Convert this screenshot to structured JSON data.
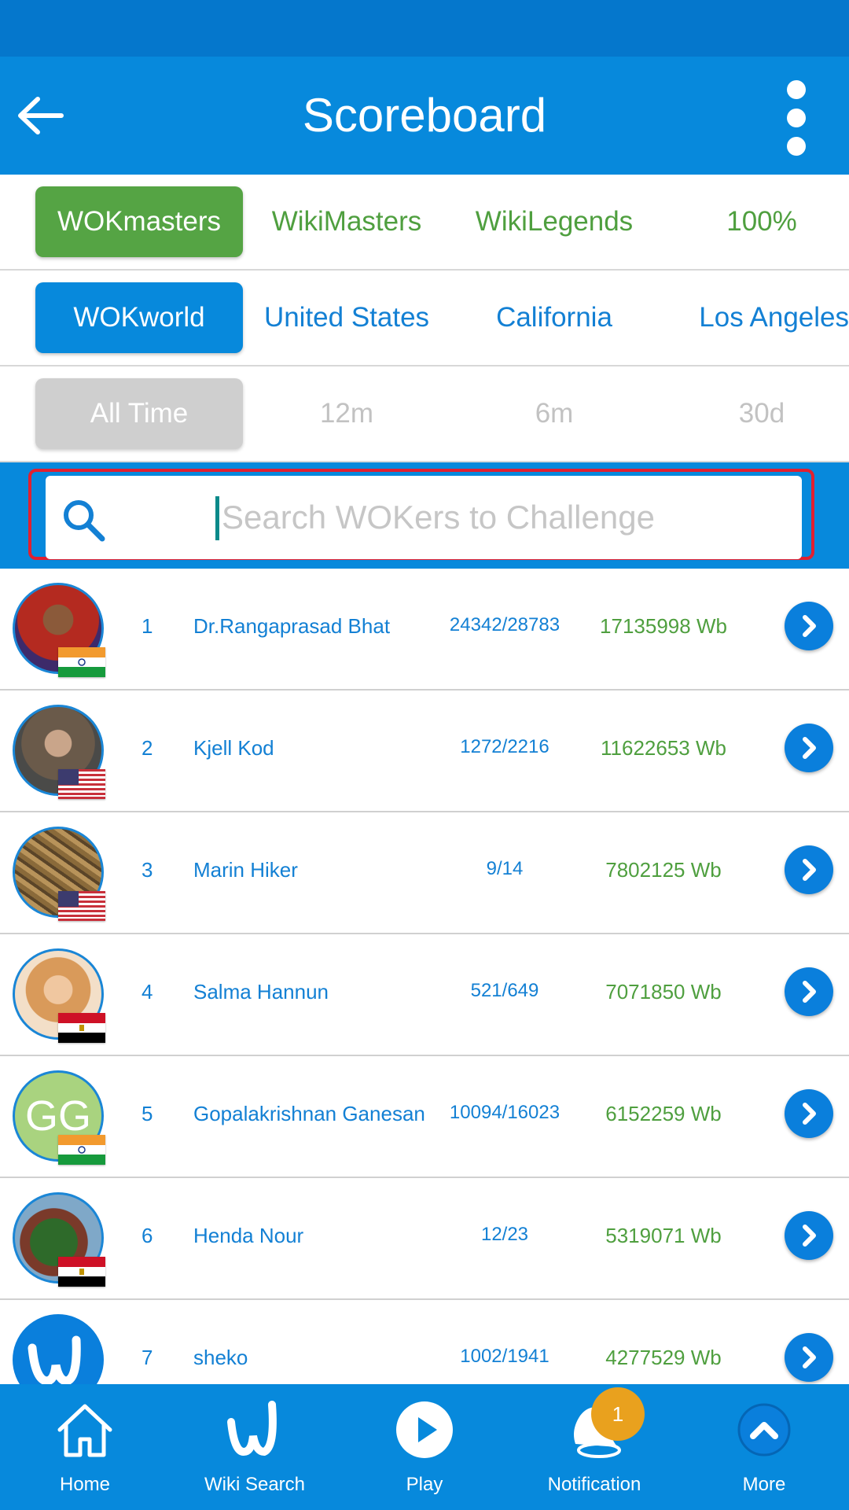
{
  "colors": {
    "primary": "#0789dc",
    "green": "#55a444",
    "link_blue": "#1380d4",
    "score_green": "#4f9f3f",
    "badge": "#e9a11e",
    "highlight": "#e12030"
  },
  "header": {
    "title": "Scoreboard",
    "back_icon": "arrow-left-icon",
    "menu_icon": "more-vertical-icon"
  },
  "tabs_category": [
    "WOKmasters",
    "WikiMasters",
    "WikiLegends",
    "100%"
  ],
  "tabs_region": [
    "WOKworld",
    "United States",
    "California",
    "Los Angeles"
  ],
  "tabs_period": [
    "All Time",
    "12m",
    "6m",
    "30d"
  ],
  "search": {
    "placeholder": "Search WOKers to Challenge",
    "icon": "search-icon"
  },
  "players": [
    {
      "rank": "1",
      "name": "Dr.Rangaprasad Bhat",
      "ratio": "24342/28783",
      "score": "17135998 Wb",
      "flag": "India",
      "avatar": "photo"
    },
    {
      "rank": "2",
      "name": "Kjell Kod",
      "ratio": "1272/2216",
      "score": "11622653 Wb",
      "flag": "United States",
      "avatar": "photo"
    },
    {
      "rank": "3",
      "name": "Marin Hiker",
      "ratio": "9/14",
      "score": "7802125 Wb",
      "flag": "United States",
      "avatar": "photo"
    },
    {
      "rank": "4",
      "name": "Salma Hannun",
      "ratio": "521/649",
      "score": "7071850 Wb",
      "flag": "Egypt",
      "avatar": "photo"
    },
    {
      "rank": "5",
      "name": "Gopalakrishnan Ganesan",
      "ratio": "10094/16023",
      "score": "6152259 Wb",
      "flag": "India",
      "avatar": "GG"
    },
    {
      "rank": "6",
      "name": "Henda Nour",
      "ratio": "12/23",
      "score": "5319071 Wb",
      "flag": "Egypt",
      "avatar": "photo"
    },
    {
      "rank": "7",
      "name": "sheko",
      "ratio": "1002/1941",
      "score": "4277529 Wb",
      "flag": "",
      "avatar": "logo"
    }
  ],
  "bottom_nav": [
    {
      "label": "Home",
      "icon": "home-icon"
    },
    {
      "label": "Wiki Search",
      "icon": "wiki-logo-icon"
    },
    {
      "label": "Play",
      "icon": "play-icon"
    },
    {
      "label": "Notification",
      "icon": "bell-icon",
      "badge": "1"
    },
    {
      "label": "More",
      "icon": "chevron-up-icon"
    }
  ]
}
